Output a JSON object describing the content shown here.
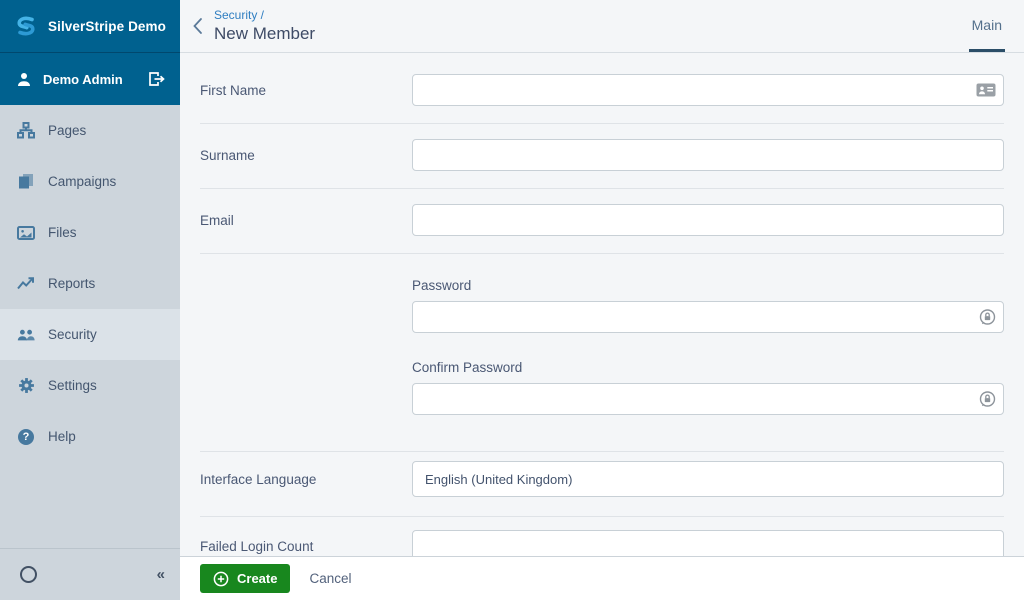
{
  "sidebar": {
    "brand": "SilverStripe Demo",
    "user": {
      "name": "Demo Admin"
    },
    "items": [
      {
        "label": "Pages",
        "icon": "sitemap-icon",
        "active": false
      },
      {
        "label": "Campaigns",
        "icon": "stack-icon",
        "active": false
      },
      {
        "label": "Files",
        "icon": "image-icon",
        "active": false
      },
      {
        "label": "Reports",
        "icon": "chart-line-icon",
        "active": false
      },
      {
        "label": "Security",
        "icon": "people-icon",
        "active": true
      },
      {
        "label": "Settings",
        "icon": "gear-icon",
        "active": false
      },
      {
        "label": "Help",
        "icon": "help-icon",
        "active": false
      }
    ]
  },
  "icons": {
    "help_glyph": "?",
    "collapse_glyph": "«"
  },
  "header": {
    "breadcrumb": "Security /",
    "title": "New Member",
    "tabs": [
      {
        "label": "Main",
        "active": true
      }
    ]
  },
  "form": {
    "first_name": {
      "label": "First Name",
      "value": ""
    },
    "surname": {
      "label": "Surname",
      "value": ""
    },
    "email": {
      "label": "Email",
      "value": ""
    },
    "password": {
      "label": "Password",
      "value": ""
    },
    "confirm_password": {
      "label": "Confirm Password",
      "value": ""
    },
    "interface_language": {
      "label": "Interface Language",
      "value": "English (United Kingdom)"
    },
    "failed_login_count": {
      "label": "Failed Login Count",
      "value": ""
    }
  },
  "footer": {
    "create": "Create",
    "cancel": "Cancel"
  },
  "colors": {
    "header_blue": "#00618f",
    "logo_blue": "#45b3e6",
    "sidebar_bg": "#cdd5dc",
    "sidebar_active_bg": "#dbe2e8",
    "icon_blue": "#47799f",
    "content_bg": "#f4f6f8",
    "link_blue": "#2f7ec1",
    "tab_underline": "#2b4e68",
    "create_green": "#18871e",
    "text_dark": "#43536d"
  }
}
